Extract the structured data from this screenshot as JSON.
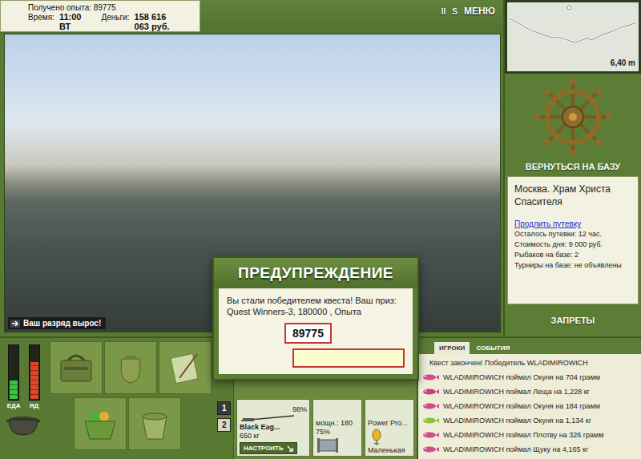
{
  "hud": {
    "experience": "Получено опыта: 89775",
    "time_label": "Время:",
    "time": "11:00 ВТ",
    "money_label": "Деньги:",
    "money": "158 616 063 руб."
  },
  "toolbar": [
    "II",
    "S",
    "МЕНЮ"
  ],
  "scene": {
    "notice": "Ваш разряд вырос!"
  },
  "depth": {
    "reading": "6,40 m",
    "profile": [
      1.2,
      1.6,
      2.1,
      2.6,
      3.0,
      3.3,
      3.6,
      3.9,
      4.1,
      4.0,
      4.3,
      4.6,
      4.8,
      4.5,
      4.2,
      4.4,
      4.0,
      3.6,
      3.3,
      3.0,
      2.6,
      2.3,
      2.1,
      1.8
    ],
    "float": {
      "level": 0.47
    }
  },
  "base_button": "ВЕРНУТЬСЯ НА БАЗУ",
  "location": {
    "title": "Москва. Храм Христа Спасителя",
    "link": "Продлить путевку",
    "lines": [
      "Осталось путевки: 12 час.",
      "Стоимость дня: 9 000 руб.",
      "Рыбаков на базе: 2",
      "Турниры на базе: не объявлены"
    ]
  },
  "bans_button": "ЗАПРЕТЫ",
  "gauges": [
    {
      "label": "ЕДА",
      "level": 0.35,
      "color": "#3cc23c"
    },
    {
      "label": "ЯД",
      "level": 0.7,
      "color": "#e2452f"
    }
  ],
  "pages": [
    {
      "label": "1",
      "selected": true
    },
    {
      "label": "2",
      "selected": false
    }
  ],
  "rod": {
    "condition": "98%",
    "name": "Black Eag...",
    "weight": "650 кг",
    "setup_button": "НАСТРОИТЬ",
    "power": "мощн.: 180",
    "line_condition": "75%",
    "line": "Power Pro...",
    "hook": "Маленькая"
  },
  "chat": {
    "tabs": [
      {
        "label": "ИГРОКИ",
        "selected": true
      },
      {
        "label": "СОБЫТИЯ",
        "selected": false
      }
    ],
    "messages": [
      {
        "kind": "system",
        "text": "Квест закончен! Победитель WLADIMIROWICH"
      },
      {
        "kind": "catch",
        "text": "WLADIMIROWICH поймал Окуня на 704 грамм",
        "color": "#d24b8a"
      },
      {
        "kind": "catch",
        "text": "WLADIMIROWICH поймал Леща на 1,228 кг",
        "color": "#c93f7a"
      },
      {
        "kind": "catch",
        "text": "WLADIMIROWICH поймал Окуня на 184 грамм",
        "color": "#d24b8a"
      },
      {
        "kind": "catch",
        "text": "WLADIMIROWICH поймал Окуня на 1,134 кг",
        "color": "#8fbf45"
      },
      {
        "kind": "catch",
        "text": "WLADIMIROWICH поймал Плотву на 326 грамм",
        "color": "#d24b8a"
      },
      {
        "kind": "catch",
        "text": "WLADIMIROWICH поймал Щуку на 4,165 кг",
        "color": "#c9508c"
      }
    ]
  },
  "dialog": {
    "title": "ПРЕДУПРЕЖДЕНИЕ",
    "message": "Вы стали победителем квеста! Ваш приз: Quest Winners-3, 180000 , Опыта",
    "value": "89775",
    "input": ""
  }
}
